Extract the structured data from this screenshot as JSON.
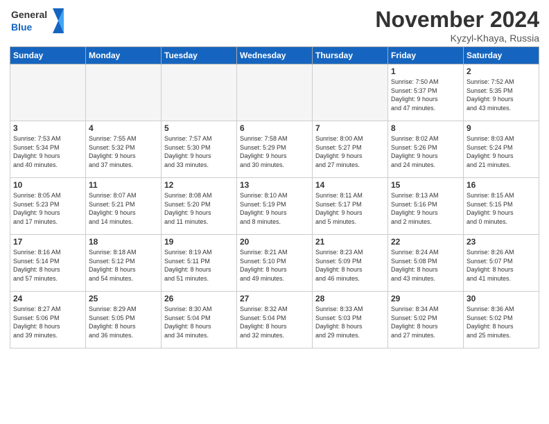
{
  "header": {
    "logo_line1": "General",
    "logo_line2": "Blue",
    "month": "November 2024",
    "location": "Kyzyl-Khaya, Russia"
  },
  "weekdays": [
    "Sunday",
    "Monday",
    "Tuesday",
    "Wednesday",
    "Thursday",
    "Friday",
    "Saturday"
  ],
  "weeks": [
    [
      {
        "day": "",
        "info": ""
      },
      {
        "day": "",
        "info": ""
      },
      {
        "day": "",
        "info": ""
      },
      {
        "day": "",
        "info": ""
      },
      {
        "day": "",
        "info": ""
      },
      {
        "day": "1",
        "info": "Sunrise: 7:50 AM\nSunset: 5:37 PM\nDaylight: 9 hours\nand 47 minutes."
      },
      {
        "day": "2",
        "info": "Sunrise: 7:52 AM\nSunset: 5:35 PM\nDaylight: 9 hours\nand 43 minutes."
      }
    ],
    [
      {
        "day": "3",
        "info": "Sunrise: 7:53 AM\nSunset: 5:34 PM\nDaylight: 9 hours\nand 40 minutes."
      },
      {
        "day": "4",
        "info": "Sunrise: 7:55 AM\nSunset: 5:32 PM\nDaylight: 9 hours\nand 37 minutes."
      },
      {
        "day": "5",
        "info": "Sunrise: 7:57 AM\nSunset: 5:30 PM\nDaylight: 9 hours\nand 33 minutes."
      },
      {
        "day": "6",
        "info": "Sunrise: 7:58 AM\nSunset: 5:29 PM\nDaylight: 9 hours\nand 30 minutes."
      },
      {
        "day": "7",
        "info": "Sunrise: 8:00 AM\nSunset: 5:27 PM\nDaylight: 9 hours\nand 27 minutes."
      },
      {
        "day": "8",
        "info": "Sunrise: 8:02 AM\nSunset: 5:26 PM\nDaylight: 9 hours\nand 24 minutes."
      },
      {
        "day": "9",
        "info": "Sunrise: 8:03 AM\nSunset: 5:24 PM\nDaylight: 9 hours\nand 21 minutes."
      }
    ],
    [
      {
        "day": "10",
        "info": "Sunrise: 8:05 AM\nSunset: 5:23 PM\nDaylight: 9 hours\nand 17 minutes."
      },
      {
        "day": "11",
        "info": "Sunrise: 8:07 AM\nSunset: 5:21 PM\nDaylight: 9 hours\nand 14 minutes."
      },
      {
        "day": "12",
        "info": "Sunrise: 8:08 AM\nSunset: 5:20 PM\nDaylight: 9 hours\nand 11 minutes."
      },
      {
        "day": "13",
        "info": "Sunrise: 8:10 AM\nSunset: 5:19 PM\nDaylight: 9 hours\nand 8 minutes."
      },
      {
        "day": "14",
        "info": "Sunrise: 8:11 AM\nSunset: 5:17 PM\nDaylight: 9 hours\nand 5 minutes."
      },
      {
        "day": "15",
        "info": "Sunrise: 8:13 AM\nSunset: 5:16 PM\nDaylight: 9 hours\nand 2 minutes."
      },
      {
        "day": "16",
        "info": "Sunrise: 8:15 AM\nSunset: 5:15 PM\nDaylight: 9 hours\nand 0 minutes."
      }
    ],
    [
      {
        "day": "17",
        "info": "Sunrise: 8:16 AM\nSunset: 5:14 PM\nDaylight: 8 hours\nand 57 minutes."
      },
      {
        "day": "18",
        "info": "Sunrise: 8:18 AM\nSunset: 5:12 PM\nDaylight: 8 hours\nand 54 minutes."
      },
      {
        "day": "19",
        "info": "Sunrise: 8:19 AM\nSunset: 5:11 PM\nDaylight: 8 hours\nand 51 minutes."
      },
      {
        "day": "20",
        "info": "Sunrise: 8:21 AM\nSunset: 5:10 PM\nDaylight: 8 hours\nand 49 minutes."
      },
      {
        "day": "21",
        "info": "Sunrise: 8:23 AM\nSunset: 5:09 PM\nDaylight: 8 hours\nand 46 minutes."
      },
      {
        "day": "22",
        "info": "Sunrise: 8:24 AM\nSunset: 5:08 PM\nDaylight: 8 hours\nand 43 minutes."
      },
      {
        "day": "23",
        "info": "Sunrise: 8:26 AM\nSunset: 5:07 PM\nDaylight: 8 hours\nand 41 minutes."
      }
    ],
    [
      {
        "day": "24",
        "info": "Sunrise: 8:27 AM\nSunset: 5:06 PM\nDaylight: 8 hours\nand 39 minutes."
      },
      {
        "day": "25",
        "info": "Sunrise: 8:29 AM\nSunset: 5:05 PM\nDaylight: 8 hours\nand 36 minutes."
      },
      {
        "day": "26",
        "info": "Sunrise: 8:30 AM\nSunset: 5:04 PM\nDaylight: 8 hours\nand 34 minutes."
      },
      {
        "day": "27",
        "info": "Sunrise: 8:32 AM\nSunset: 5:04 PM\nDaylight: 8 hours\nand 32 minutes."
      },
      {
        "day": "28",
        "info": "Sunrise: 8:33 AM\nSunset: 5:03 PM\nDaylight: 8 hours\nand 29 minutes."
      },
      {
        "day": "29",
        "info": "Sunrise: 8:34 AM\nSunset: 5:02 PM\nDaylight: 8 hours\nand 27 minutes."
      },
      {
        "day": "30",
        "info": "Sunrise: 8:36 AM\nSunset: 5:02 PM\nDaylight: 8 hours\nand 25 minutes."
      }
    ]
  ]
}
